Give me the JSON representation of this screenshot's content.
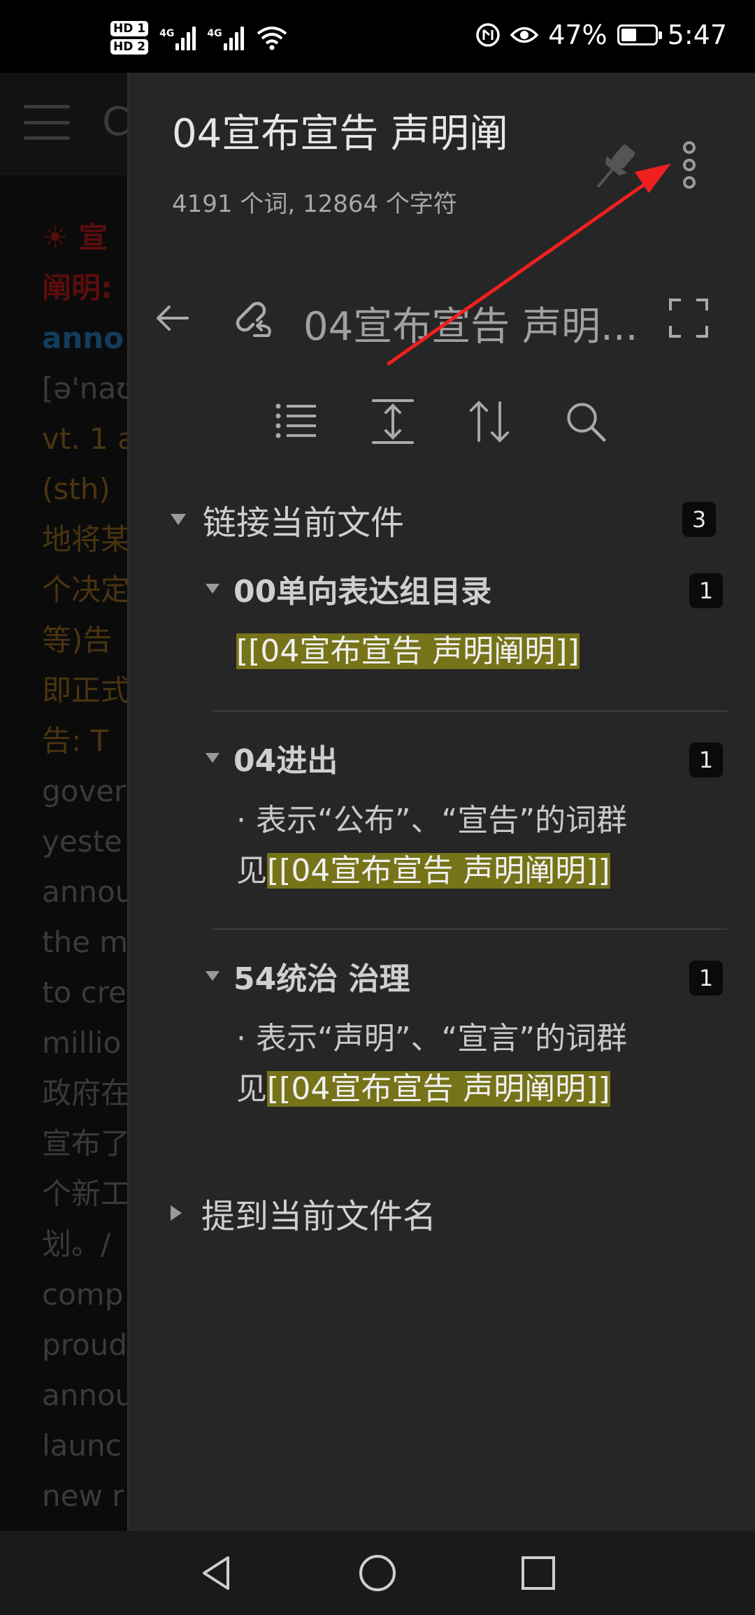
{
  "status_bar": {
    "hd1": "HD 1",
    "hd2": "HD 2",
    "sig1_label": "4G",
    "sig2_label": "4G",
    "battery_percent": "47%",
    "battery_level": 0.47,
    "time": "5:47"
  },
  "background": {
    "title_fragment": "C",
    "lines": [
      {
        "text": "☀ 宣",
        "style": "red"
      },
      {
        "text": "阐明:",
        "style": "red"
      },
      {
        "text": "anno",
        "style": "blue"
      },
      {
        "text": "[ə'naʊ",
        "style": "dim"
      },
      {
        "text": "vt. 1 a",
        "style": "brown"
      },
      {
        "text": "(sth)",
        "style": "brown"
      },
      {
        "text": "地将某",
        "style": "brown"
      },
      {
        "text": "个决定",
        "style": "brown"
      },
      {
        "text": "等)告",
        "style": "brown"
      },
      {
        "text": "即正式",
        "style": "brown"
      },
      {
        "text": "告: T",
        "style": "brown"
      },
      {
        "text": "gover",
        "style": "dim"
      },
      {
        "text": "yeste",
        "style": "dim"
      },
      {
        "text": "annou",
        "style": "dim"
      },
      {
        "text": "the m",
        "style": "dim"
      },
      {
        "text": "to cre",
        "style": "dim"
      },
      {
        "text": "millio",
        "style": "dim"
      },
      {
        "text": "政府在",
        "style": "dim"
      },
      {
        "text": "宣布了",
        "style": "dim"
      },
      {
        "text": "个新工",
        "style": "dim"
      },
      {
        "text": "划。/",
        "style": "dim"
      },
      {
        "text": "comp",
        "style": "dim"
      },
      {
        "text": "proud",
        "style": "dim"
      },
      {
        "text": "annou",
        "style": "dim"
      },
      {
        "text": "launc",
        "style": "dim"
      },
      {
        "text": "new r",
        "style": "dim"
      }
    ]
  },
  "panel": {
    "title": "04宣布宣告 声明阐",
    "stats": "4191 个词, 12864 个字符",
    "nav_title": "04宣布宣告 声明...",
    "linked_section": {
      "label": "链接当前文件",
      "count": "3",
      "groups": [
        {
          "title": "00单向表达组目录",
          "count": "1",
          "prefix": "",
          "link": "[[04宣布宣告 声明阐明]]"
        },
        {
          "title": "04进出",
          "count": "1",
          "line1": "· 表示“公布”、“宣告”的词群",
          "prefix": "见",
          "link": "[[04宣布宣告 声明阐明]]"
        },
        {
          "title": "54统治 治理",
          "count": "1",
          "line1": "· 表示“声明”、“宣言”的词群",
          "prefix": "见",
          "link": "[[04宣布宣告 声明阐明]]"
        }
      ]
    },
    "mentions_section": {
      "label": "提到当前文件名"
    }
  },
  "colors": {
    "panel_bg": "#262626",
    "highlight": "#767319",
    "annotation_arrow": "#f02020"
  }
}
